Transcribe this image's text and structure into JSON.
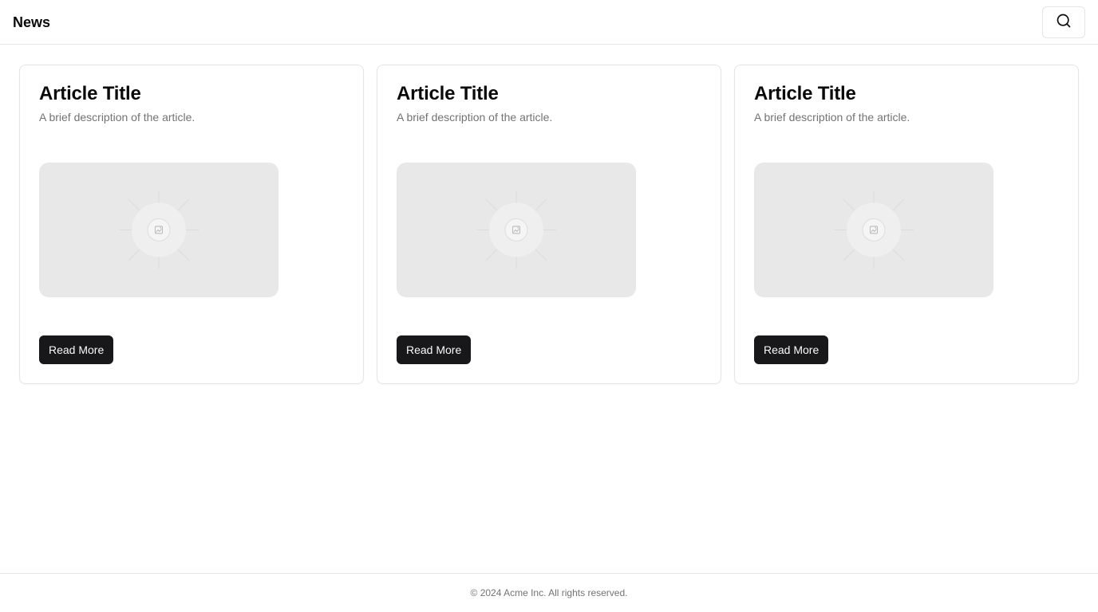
{
  "header": {
    "title": "News",
    "search_icon": "search-icon"
  },
  "articles": [
    {
      "title": "Article Title",
      "description": "A brief description of the article.",
      "image_icon": "image-placeholder-icon",
      "button_label": "Read More"
    },
    {
      "title": "Article Title",
      "description": "A brief description of the article.",
      "image_icon": "image-placeholder-icon",
      "button_label": "Read More"
    },
    {
      "title": "Article Title",
      "description": "A brief description of the article.",
      "image_icon": "image-placeholder-icon",
      "button_label": "Read More"
    }
  ],
  "footer": {
    "copyright": "© 2024 Acme Inc. All rights reserved."
  },
  "colors": {
    "button_bg": "#18181b",
    "button_text": "#fafafa",
    "muted_text": "#737373",
    "border": "#e5e5e5",
    "placeholder_bg": "#e8e8e8"
  }
}
